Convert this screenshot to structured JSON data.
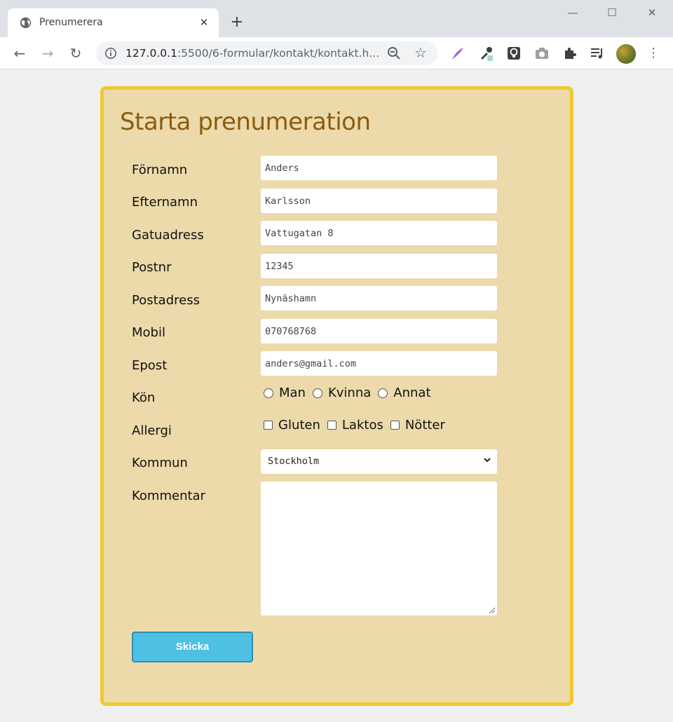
{
  "browser": {
    "tab_title": "Prenumerera",
    "url_host": "127.0.0.1",
    "url_rest": ":5500/6-formular/kontakt/kontakt.h..."
  },
  "form": {
    "heading": "Starta prenumeration",
    "fields": {
      "fornamn": {
        "label": "Förnamn",
        "value": "Anders"
      },
      "efternamn": {
        "label": "Efternamn",
        "value": "Karlsson"
      },
      "gatuadress": {
        "label": "Gatuadress",
        "value": "Vattugatan 8"
      },
      "postnr": {
        "label": "Postnr",
        "value": "12345"
      },
      "postadress": {
        "label": "Postadress",
        "value": "Nynäshamn"
      },
      "mobil": {
        "label": "Mobil",
        "value": "070768768"
      },
      "epost": {
        "label": "Epost",
        "value": "anders@gmail.com"
      }
    },
    "kon": {
      "label": "Kön",
      "options": [
        "Man",
        "Kvinna",
        "Annat"
      ]
    },
    "allergi": {
      "label": "Allergi",
      "options": [
        "Gluten",
        "Laktos",
        "Nötter"
      ]
    },
    "kommun": {
      "label": "Kommun",
      "selected": "Stockholm"
    },
    "kommentar": {
      "label": "Kommentar",
      "value": ""
    },
    "submit_label": "Skicka"
  },
  "colors": {
    "card_bg": "#ecdaaa",
    "card_border": "#f0c832",
    "heading": "#8a5c10",
    "button": "#4ec0e4"
  }
}
